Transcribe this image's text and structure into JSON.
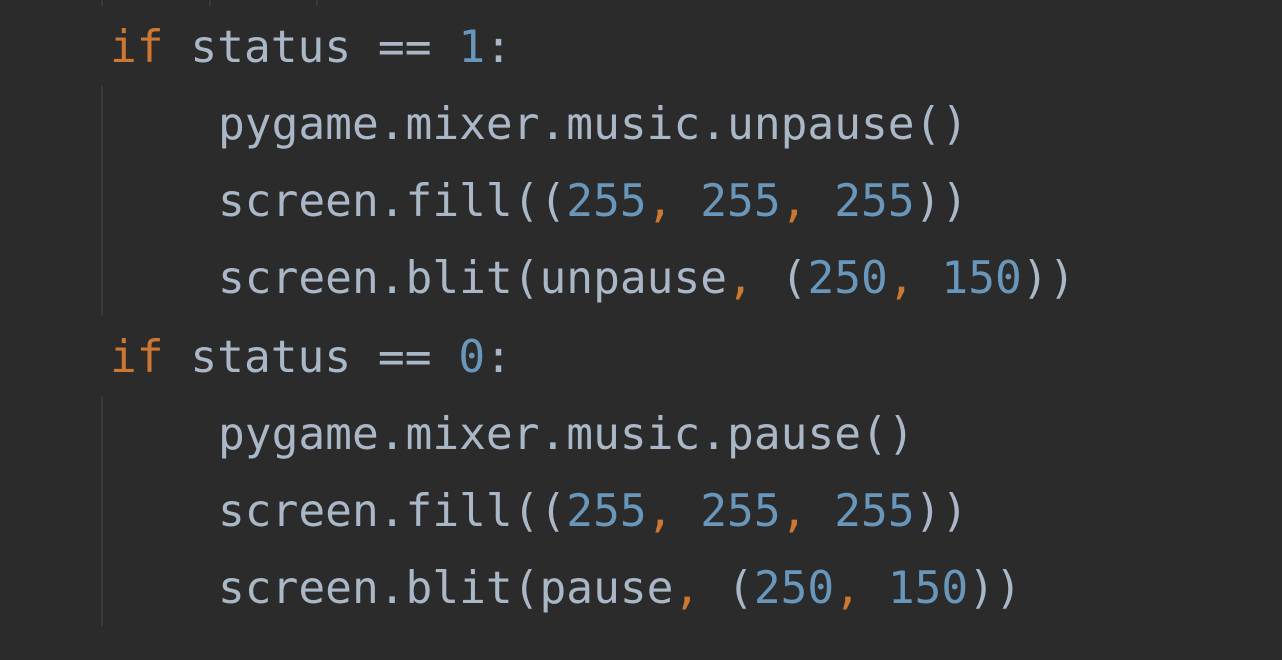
{
  "colors": {
    "background": "#2b2b2b",
    "default_text": "#a9b7c6",
    "keyword": "#cc7832",
    "number": "#6897bb",
    "comma": "#cc7832",
    "indent_guide": "#3a3a3a"
  },
  "code": {
    "lines": [
      [
        {
          "t": "if",
          "c": "kw"
        },
        {
          "t": " status == ",
          "c": "txt"
        },
        {
          "t": "1",
          "c": "num"
        },
        {
          "t": ":",
          "c": "txt"
        }
      ],
      [
        {
          "t": "pygame.mixer.music.unpause()",
          "c": "txt"
        }
      ],
      [
        {
          "t": "screen.fill((",
          "c": "txt"
        },
        {
          "t": "255",
          "c": "num"
        },
        {
          "t": ", ",
          "c": "punc"
        },
        {
          "t": "255",
          "c": "num"
        },
        {
          "t": ", ",
          "c": "punc"
        },
        {
          "t": "255",
          "c": "num"
        },
        {
          "t": "))",
          "c": "txt"
        }
      ],
      [
        {
          "t": "screen.blit(unpause",
          "c": "txt"
        },
        {
          "t": ", ",
          "c": "punc"
        },
        {
          "t": "(",
          "c": "txt"
        },
        {
          "t": "250",
          "c": "num"
        },
        {
          "t": ", ",
          "c": "punc"
        },
        {
          "t": "150",
          "c": "num"
        },
        {
          "t": "))",
          "c": "txt"
        }
      ],
      [
        {
          "t": "if",
          "c": "kw"
        },
        {
          "t": " status == ",
          "c": "txt"
        },
        {
          "t": "0",
          "c": "num"
        },
        {
          "t": ":",
          "c": "txt"
        }
      ],
      [
        {
          "t": "pygame.mixer.music.pause()",
          "c": "txt"
        }
      ],
      [
        {
          "t": "screen.fill((",
          "c": "txt"
        },
        {
          "t": "255",
          "c": "num"
        },
        {
          "t": ", ",
          "c": "punc"
        },
        {
          "t": "255",
          "c": "num"
        },
        {
          "t": ", ",
          "c": "punc"
        },
        {
          "t": "255",
          "c": "num"
        },
        {
          "t": "))",
          "c": "txt"
        }
      ],
      [
        {
          "t": "screen.blit(pause",
          "c": "txt"
        },
        {
          "t": ", ",
          "c": "punc"
        },
        {
          "t": "(",
          "c": "txt"
        },
        {
          "t": "250",
          "c": "num"
        },
        {
          "t": ", ",
          "c": "punc"
        },
        {
          "t": "150",
          "c": "num"
        },
        {
          "t": "))",
          "c": "txt"
        }
      ]
    ]
  }
}
